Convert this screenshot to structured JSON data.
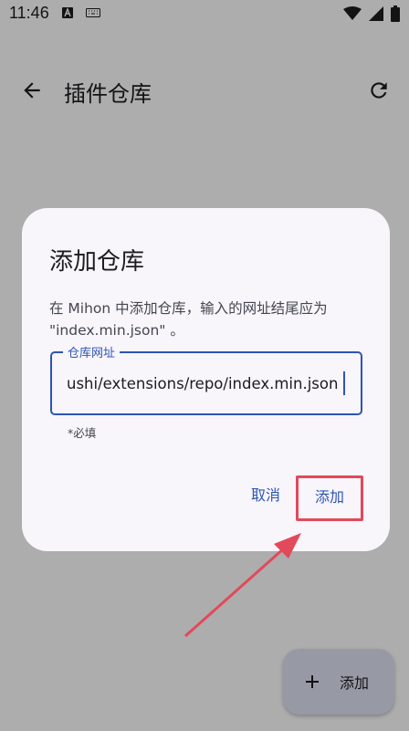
{
  "status_bar": {
    "time": "11:46"
  },
  "app_bar": {
    "title": "插件仓库"
  },
  "fab": {
    "label": "添加"
  },
  "dialog": {
    "title": "添加仓库",
    "message": "在 Mihon 中添加仓库，输入的网址结尾应为 \"index.min.json\" 。",
    "field_label": "仓库网址",
    "field_value": "ushi/extensions/repo/index.min.json",
    "supporting_text": "*必填",
    "cancel_label": "取消",
    "confirm_label": "添加"
  },
  "colors": {
    "primary": "#2d55b3",
    "highlight": "#e2495a",
    "dialog_bg": "#f8f5fb"
  }
}
